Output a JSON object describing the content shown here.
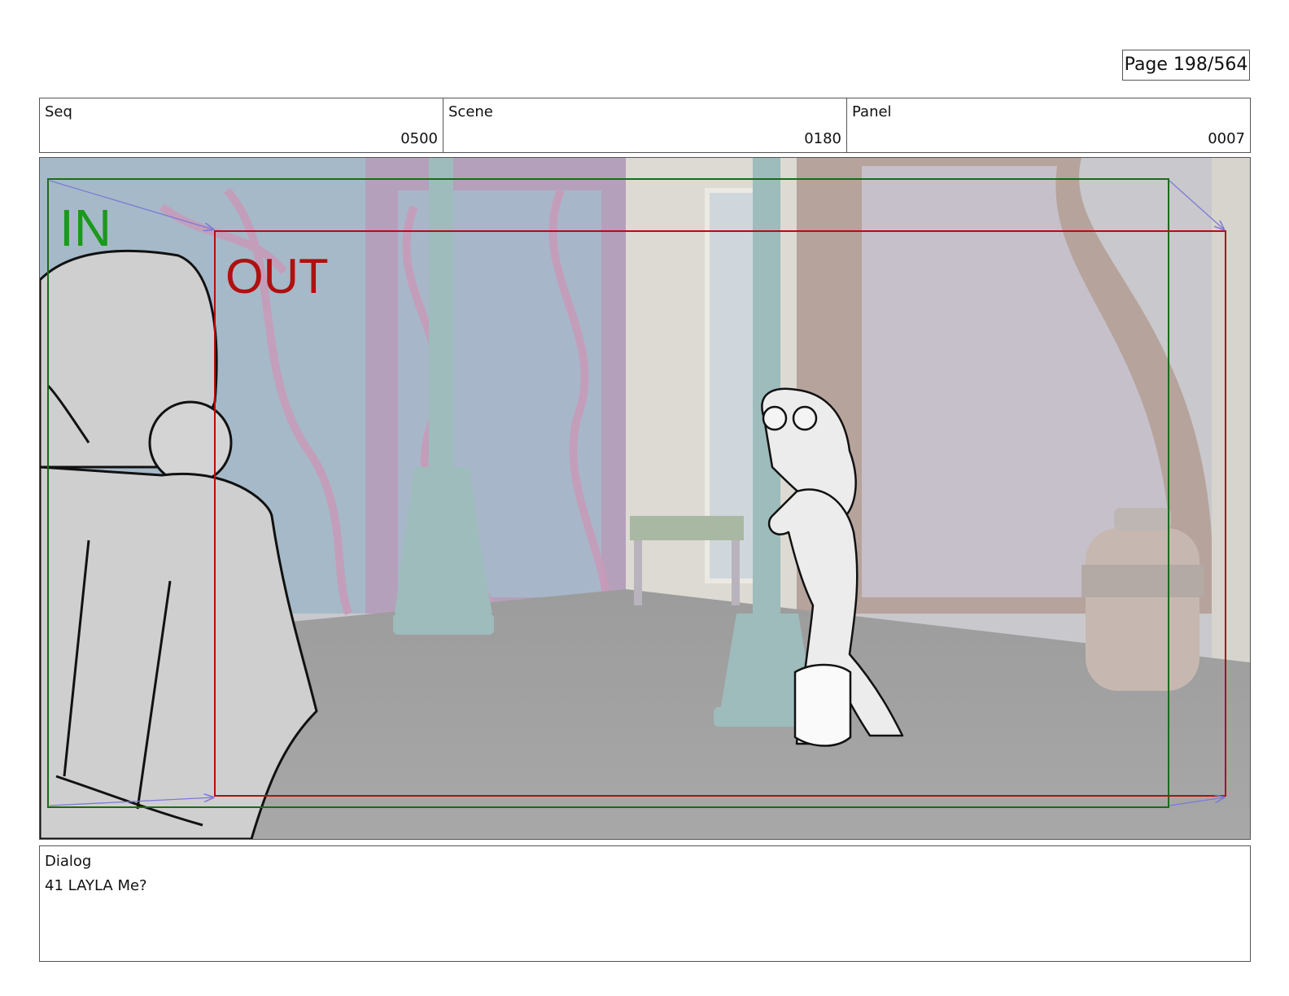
{
  "page": {
    "label": "Page 198/564"
  },
  "meta": {
    "seq": {
      "label": "Seq",
      "value": "0500"
    },
    "scene": {
      "label": "Scene",
      "value": "0180"
    },
    "panel": {
      "label": "Panel",
      "value": "0007"
    }
  },
  "frame": {
    "in_label": "IN",
    "out_label": "OUT",
    "colors": {
      "in": "#1a8a1a",
      "out": "#b01010",
      "camera_arrow": "#7a7ad6"
    }
  },
  "dialog": {
    "label": "Dialog",
    "line": "41 LAYLA Me?"
  }
}
